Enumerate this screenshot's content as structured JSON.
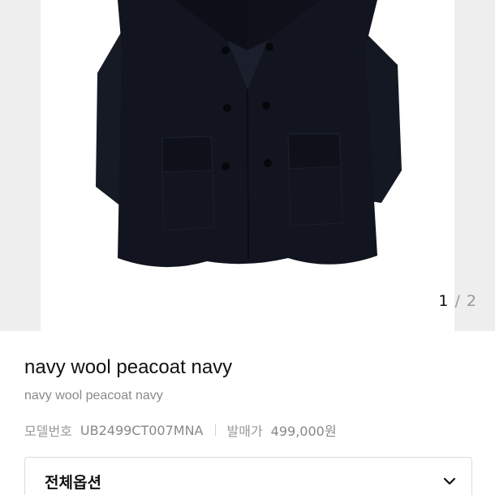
{
  "gallery": {
    "image_alt": "navy wool peacoat",
    "pager": {
      "current": "1",
      "separator": "/",
      "total": "2"
    }
  },
  "product": {
    "title": "navy wool peacoat navy",
    "subtitle": "navy wool peacoat navy",
    "model_label": "모델번호",
    "model_value": "UB2499CT007MNA",
    "price_label": "발매가",
    "price_value": "499,000원"
  },
  "options": {
    "label": "전체옵션",
    "icon": "chevron-down-icon"
  },
  "colors": {
    "coat": "#12151f",
    "gallery_bg": "#eeeeee",
    "muted_text": "#999999"
  }
}
